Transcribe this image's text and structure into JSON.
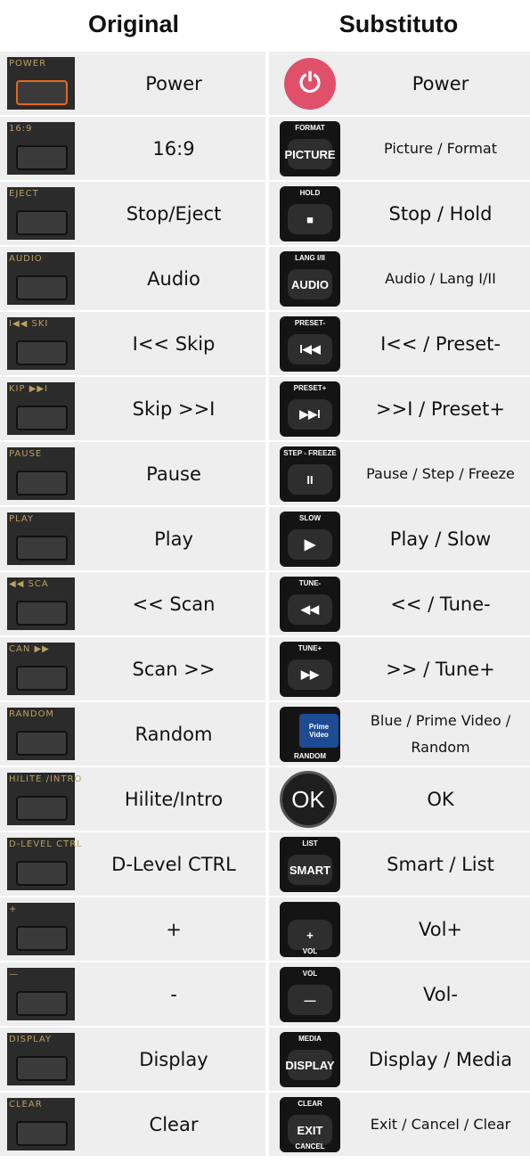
{
  "headers": {
    "original": "Original",
    "substitute": "Substituto"
  },
  "rows": [
    {
      "orig_icon": "POWER",
      "orig": "Power",
      "sub_top": "",
      "sub_btn": "⏻",
      "sub_bottom": "",
      "sub": "Power"
    },
    {
      "orig_icon": "16:9",
      "orig": "16:9",
      "sub_top": "FORMAT",
      "sub_btn": "PICTURE",
      "sub_bottom": "",
      "sub": "Picture / Format"
    },
    {
      "orig_icon": "EJECT",
      "orig": "Stop/Eject",
      "sub_top": "HOLD",
      "sub_btn": "■",
      "sub_bottom": "",
      "sub": "Stop / Hold"
    },
    {
      "orig_icon": "AUDIO",
      "orig": "Audio",
      "sub_top": "LANG I/II",
      "sub_btn": "AUDIO",
      "sub_bottom": "",
      "sub": "Audio / Lang I/II"
    },
    {
      "orig_icon": "I◀◀ SKI",
      "orig": "I<< Skip",
      "sub_top": "PRESET-",
      "sub_btn": "I◀◀",
      "sub_bottom": "",
      "sub": "I<< / Preset-"
    },
    {
      "orig_icon": "KIP ▶▶I",
      "orig": "Skip >>I",
      "sub_top": "PRESET+",
      "sub_btn": "▶▶I",
      "sub_bottom": "",
      "sub": ">>I / Preset+"
    },
    {
      "orig_icon": "PAUSE",
      "orig": "Pause",
      "sub_top": "STEP - FREEZE",
      "sub_btn": "II",
      "sub_bottom": "",
      "sub": "Pause / Step / Freeze"
    },
    {
      "orig_icon": "PLAY",
      "orig": "Play",
      "sub_top": "SLOW",
      "sub_btn": "▶",
      "sub_bottom": "",
      "sub": "Play / Slow"
    },
    {
      "orig_icon": "◀◀ SCA",
      "orig": "<< Scan",
      "sub_top": "TUNE-",
      "sub_btn": "◀◀",
      "sub_bottom": "",
      "sub": "<< / Tune-"
    },
    {
      "orig_icon": "CAN ▶▶",
      "orig": "Scan >>",
      "sub_top": "TUNE+",
      "sub_btn": "▶▶",
      "sub_bottom": "",
      "sub": ">> / Tune+"
    },
    {
      "orig_icon": "RANDOM",
      "orig": "Random",
      "sub_top": "Prime Video",
      "sub_btn": "",
      "sub_bottom": "RANDOM",
      "sub": "Blue / Prime Video / Random"
    },
    {
      "orig_icon": "HILITE /INTRO",
      "orig": "Hilite/Intro",
      "sub_top": "",
      "sub_btn": "OK",
      "sub_bottom": "",
      "sub": "OK"
    },
    {
      "orig_icon": "D-LEVEL CTRL",
      "orig": "D-Level CTRL",
      "sub_top": "LIST",
      "sub_btn": "SMART",
      "sub_bottom": "",
      "sub": "Smart / List"
    },
    {
      "orig_icon": "+",
      "orig": "+",
      "sub_top": "",
      "sub_btn": "+",
      "sub_bottom": "VOL",
      "sub": "Vol+"
    },
    {
      "orig_icon": "—",
      "orig": "-",
      "sub_top": "VOL",
      "sub_btn": "—",
      "sub_bottom": "",
      "sub": "Vol-"
    },
    {
      "orig_icon": "DISPLAY",
      "orig": "Display",
      "sub_top": "MEDIA",
      "sub_btn": "DISPLAY",
      "sub_bottom": "",
      "sub": "Display / Media"
    },
    {
      "orig_icon": "CLEAR",
      "orig": "Clear",
      "sub_top": "CLEAR",
      "sub_btn": "EXIT",
      "sub_bottom": "CANCEL",
      "sub": "Exit / Cancel / Clear"
    }
  ]
}
